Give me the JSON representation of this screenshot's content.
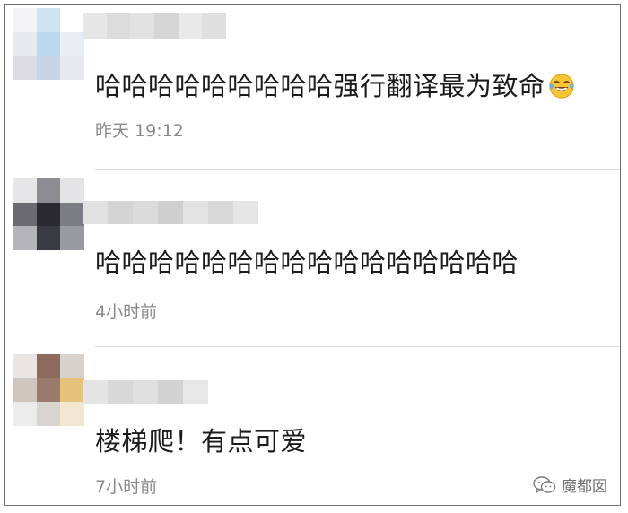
{
  "comments": [
    {
      "text": "哈哈哈哈哈哈哈哈哈强行翻译最为致命",
      "emoji": "tears-of-joy-emoji",
      "time": "昨天 19:12",
      "avatar_colors": [
        "#f3f3f5",
        "#cfe3f2",
        "#ffffff",
        "#e6e9ee",
        "#bcd8f0",
        "#e9eef4",
        "#dcdde4",
        "#c9d3e6",
        "#e5e8ee"
      ],
      "username_colors": [
        "#e6e6e6",
        "#dcdcdc",
        "#e2e2e2",
        "#d6d6d6",
        "#e9e9e9",
        "#dfdfdf"
      ]
    },
    {
      "text": "哈哈哈哈哈哈哈哈哈哈哈哈哈哈哈哈",
      "time": "4小时前",
      "avatar_colors": [
        "#e6e6e8",
        "#8c8c92",
        "#e4e4e6",
        "#6a6a70",
        "#2a2a30",
        "#7c7c84",
        "#b4b4b8",
        "#3a3a42",
        "#9a9aa2"
      ],
      "username_colors": [
        "#e1e1e1",
        "#d4d4d4",
        "#dbdbdb",
        "#cfcfcf",
        "#e3e3e3",
        "#d9d9d9",
        "#e6e6e6"
      ]
    },
    {
      "text": "楼梯爬！有点可爱",
      "time": "7小时前",
      "avatar_colors": [
        "#e8e5e3",
        "#8c6a5e",
        "#d9d2cc",
        "#cfc6c0",
        "#9a7a6c",
        "#e6c27a",
        "#ececec",
        "#d8d4cf",
        "#f1e6cf"
      ],
      "username_colors": [
        "#e4e4e4",
        "#d8d8d8",
        "#e0e0e0",
        "#d3d3d3",
        "#e7e7e7"
      ]
    }
  ],
  "watermark": {
    "icon": "wechat-icon",
    "label": "魔都囡"
  }
}
